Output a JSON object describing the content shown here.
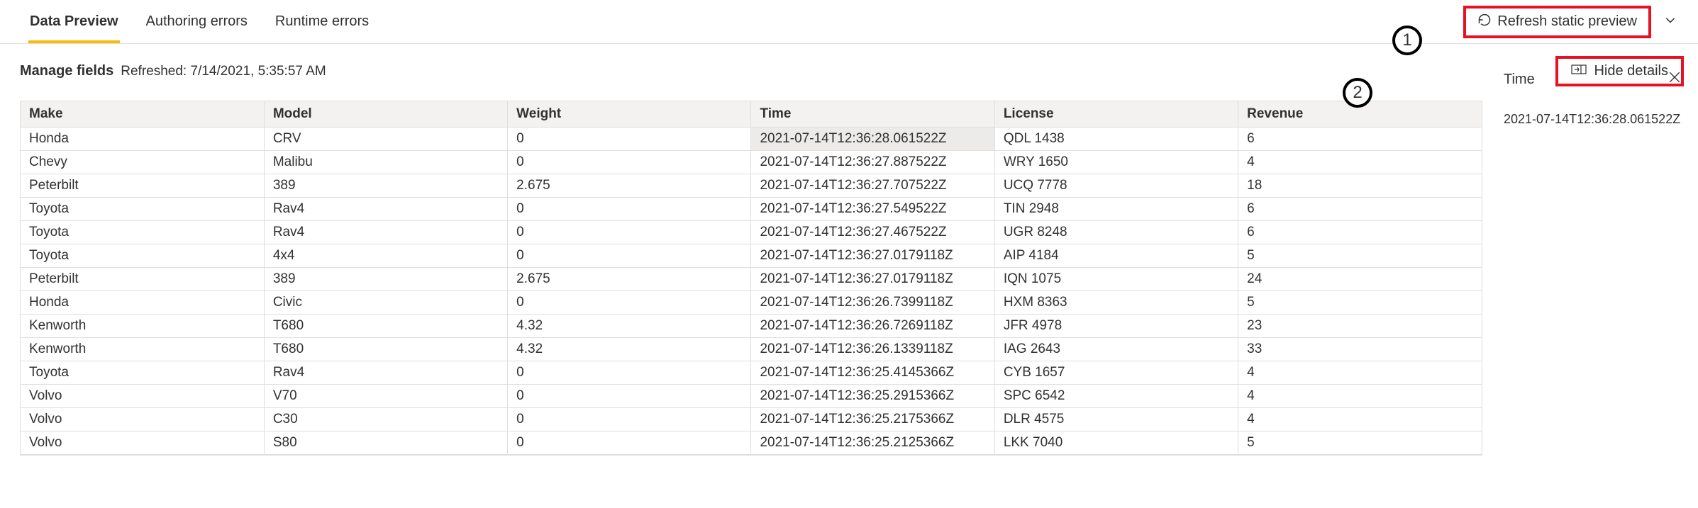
{
  "tabs": [
    {
      "label": "Data Preview",
      "active": true
    },
    {
      "label": "Authoring errors",
      "active": false
    },
    {
      "label": "Runtime errors",
      "active": false
    }
  ],
  "refresh": {
    "label": "Refresh static preview"
  },
  "callouts": {
    "one": "1",
    "two": "2"
  },
  "subbar": {
    "manage_label": "Manage fields",
    "refreshed": "Refreshed: 7/14/2021, 5:35:57 AM",
    "hide_details": "Hide details"
  },
  "table": {
    "columns": [
      "Make",
      "Model",
      "Weight",
      "Time",
      "License",
      "Revenue"
    ],
    "rows": [
      {
        "make": "Honda",
        "model": "CRV",
        "weight": "0",
        "time": "2021-07-14T12:36:28.061522Z",
        "license": "QDL 1438",
        "revenue": "6",
        "selected": true
      },
      {
        "make": "Chevy",
        "model": "Malibu",
        "weight": "0",
        "time": "2021-07-14T12:36:27.887522Z",
        "license": "WRY 1650",
        "revenue": "4"
      },
      {
        "make": "Peterbilt",
        "model": "389",
        "weight": "2.675",
        "time": "2021-07-14T12:36:27.707522Z",
        "license": "UCQ 7778",
        "revenue": "18"
      },
      {
        "make": "Toyota",
        "model": "Rav4",
        "weight": "0",
        "time": "2021-07-14T12:36:27.549522Z",
        "license": "TIN 2948",
        "revenue": "6"
      },
      {
        "make": "Toyota",
        "model": "Rav4",
        "weight": "0",
        "time": "2021-07-14T12:36:27.467522Z",
        "license": "UGR 8248",
        "revenue": "6"
      },
      {
        "make": "Toyota",
        "model": "4x4",
        "weight": "0",
        "time": "2021-07-14T12:36:27.0179118Z",
        "license": "AIP 4184",
        "revenue": "5"
      },
      {
        "make": "Peterbilt",
        "model": "389",
        "weight": "2.675",
        "time": "2021-07-14T12:36:27.0179118Z",
        "license": "IQN 1075",
        "revenue": "24"
      },
      {
        "make": "Honda",
        "model": "Civic",
        "weight": "0",
        "time": "2021-07-14T12:36:26.7399118Z",
        "license": "HXM 8363",
        "revenue": "5"
      },
      {
        "make": "Kenworth",
        "model": "T680",
        "weight": "4.32",
        "time": "2021-07-14T12:36:26.7269118Z",
        "license": "JFR 4978",
        "revenue": "23"
      },
      {
        "make": "Kenworth",
        "model": "T680",
        "weight": "4.32",
        "time": "2021-07-14T12:36:26.1339118Z",
        "license": "IAG 2643",
        "revenue": "33"
      },
      {
        "make": "Toyota",
        "model": "Rav4",
        "weight": "0",
        "time": "2021-07-14T12:36:25.4145366Z",
        "license": "CYB 1657",
        "revenue": "4"
      },
      {
        "make": "Volvo",
        "model": "V70",
        "weight": "0",
        "time": "2021-07-14T12:36:25.2915366Z",
        "license": "SPC 6542",
        "revenue": "4"
      },
      {
        "make": "Volvo",
        "model": "C30",
        "weight": "0",
        "time": "2021-07-14T12:36:25.2175366Z",
        "license": "DLR 4575",
        "revenue": "4"
      },
      {
        "make": "Volvo",
        "model": "S80",
        "weight": "0",
        "time": "2021-07-14T12:36:25.2125366Z",
        "license": "LKK 7040",
        "revenue": "5"
      }
    ]
  },
  "detail": {
    "title": "Time",
    "value": "2021-07-14T12:36:28.061522Z"
  }
}
